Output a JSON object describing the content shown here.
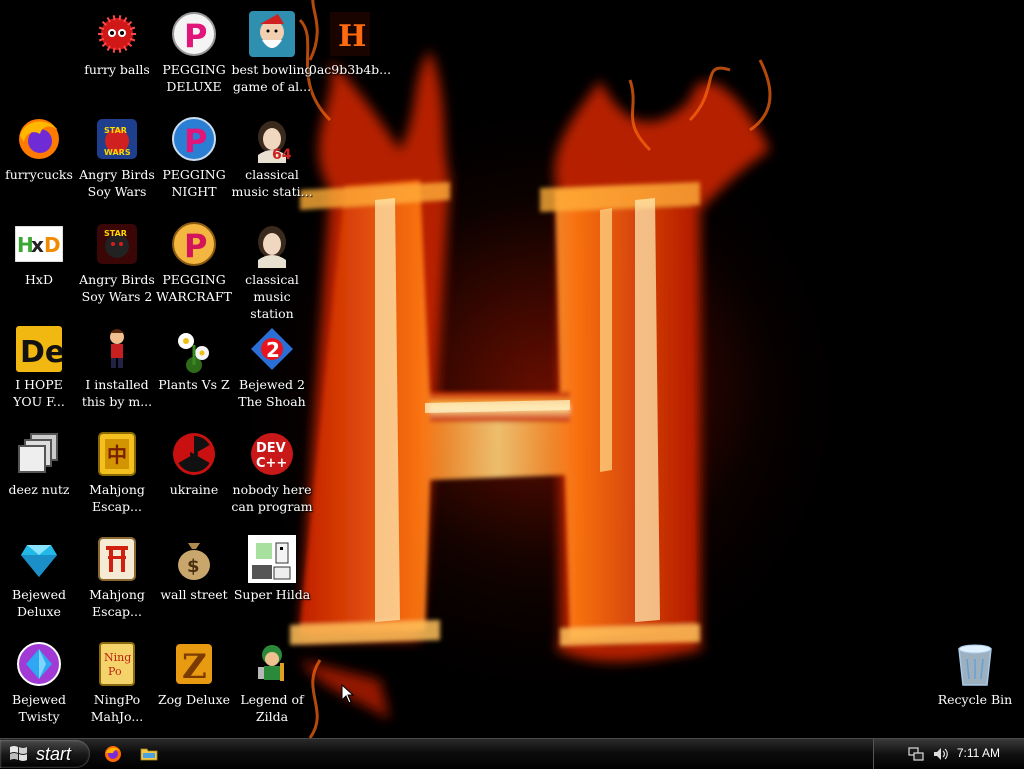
{
  "desktop": {
    "icons": [
      {
        "label": "furry balls",
        "icon": "red-furball-icon"
      },
      {
        "label": "PEGGING\nDELUXE",
        "icon": "pegging-p-icon"
      },
      {
        "label": "best bowling\ngame of al...",
        "icon": "bowling-santa-icon"
      },
      {
        "label": "0ac9b3b4b...",
        "icon": "fire-h-icon"
      },
      {
        "label": "furrycucks",
        "icon": "firefox-icon"
      },
      {
        "label": "Angry Birds\nSoy Wars",
        "icon": "angry-birds-star-wars-icon"
      },
      {
        "label": "PEGGING\nNIGHT",
        "icon": "pegging-night-icon"
      },
      {
        "label": "classical\nmusic stati...",
        "icon": "classical-music-64-icon"
      },
      {
        "label": "HxD",
        "icon": "hxd-icon"
      },
      {
        "label": "Angry Birds\nSoy Wars 2",
        "icon": "angry-birds-star-wars-2-icon"
      },
      {
        "label": "PEGGING\nWARCRAFT",
        "icon": "pegging-warcraft-icon"
      },
      {
        "label": "classical\nmusic station",
        "icon": "classical-music-icon"
      },
      {
        "label": "I HOPE\nYOU F...",
        "icon": "de-icon"
      },
      {
        "label": "I installed\nthis by m...",
        "icon": "runner-character-icon"
      },
      {
        "label": "Plants Vs Z",
        "icon": "plants-flower-icon"
      },
      {
        "label": "Bejewed 2\nThe Shoah",
        "icon": "bejeweled-2-icon"
      },
      {
        "label": "deez nutz",
        "icon": "stacked-windows-icon"
      },
      {
        "label": "Mahjong\nEscap...",
        "icon": "mahjong-tile-icon"
      },
      {
        "label": "ukraine",
        "icon": "radiation-icon"
      },
      {
        "label": "nobody here\ncan program",
        "icon": "dev-cpp-icon"
      },
      {
        "label": "Bejewed\nDeluxe",
        "icon": "diamond-icon"
      },
      {
        "label": "Mahjong\nEscap...",
        "icon": "mahjong-gate-tile-icon"
      },
      {
        "label": "wall street",
        "icon": "money-bag-icon"
      },
      {
        "label": "Super Hilda",
        "icon": "pixel-character-icon"
      },
      {
        "label": "Bejewed\nTwisty",
        "icon": "bejeweled-twist-icon"
      },
      {
        "label": "NingPo\nMahJo...",
        "icon": "ningpo-tile-icon"
      },
      {
        "label": "Zog Deluxe",
        "icon": "zog-z-icon"
      },
      {
        "label": "Legend of\nZilda",
        "icon": "zelda-character-icon"
      },
      {
        "label": "Recycle Bin",
        "icon": "recycle-bin-icon"
      }
    ]
  },
  "taskbar": {
    "start_label": "start",
    "quick_launch": [
      {
        "name": "firefox",
        "icon": "firefox-icon"
      },
      {
        "name": "explorer",
        "icon": "folder-icon"
      }
    ],
    "tray": {
      "clock": "7:11 AM",
      "icons": [
        "network-icon",
        "volume-icon"
      ]
    }
  },
  "colors": {
    "flame_orange": "#ff8a1e",
    "flame_yellow": "#ffd066",
    "flame_red": "#d32a00",
    "background": "#000000"
  }
}
